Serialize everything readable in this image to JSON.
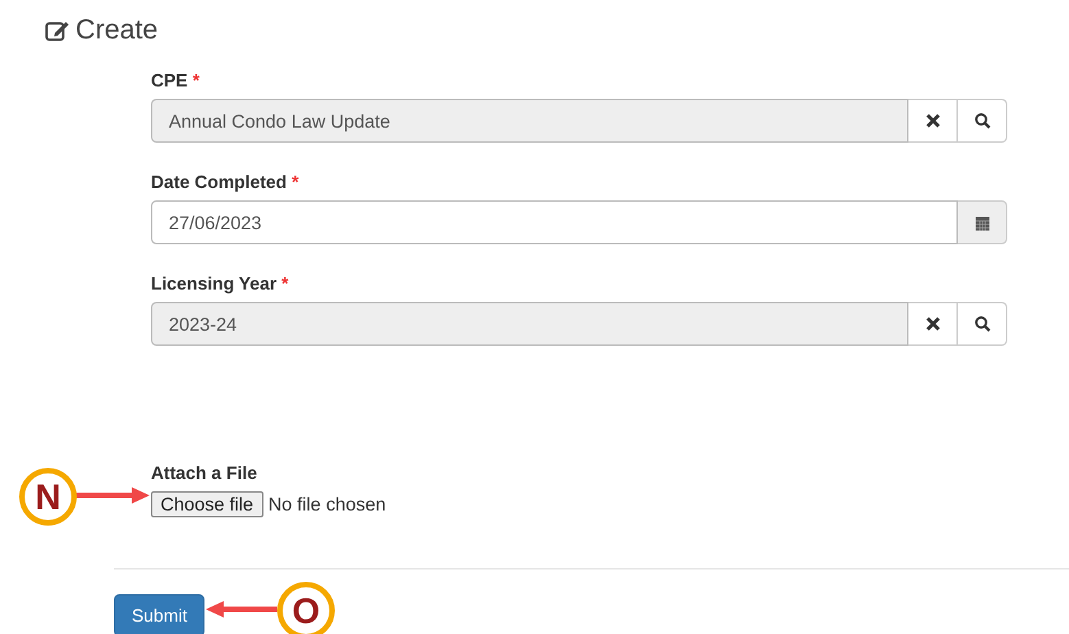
{
  "heading": "Create",
  "fields": [
    {
      "kind": "lookup",
      "label": "CPE",
      "required_mark": "*",
      "value": "Annual Condo Law Update"
    },
    {
      "kind": "date",
      "label": "Date Completed",
      "required_mark": "*",
      "value": "27/06/2023"
    },
    {
      "kind": "lookup",
      "label": "Licensing Year",
      "required_mark": "*",
      "value": "2023-24"
    }
  ],
  "attachment": {
    "label": "Attach a File",
    "button": "Choose file",
    "status": "No file chosen"
  },
  "submit": "Submit",
  "callouts": [
    {
      "letter": "N"
    },
    {
      "letter": "O"
    }
  ]
}
